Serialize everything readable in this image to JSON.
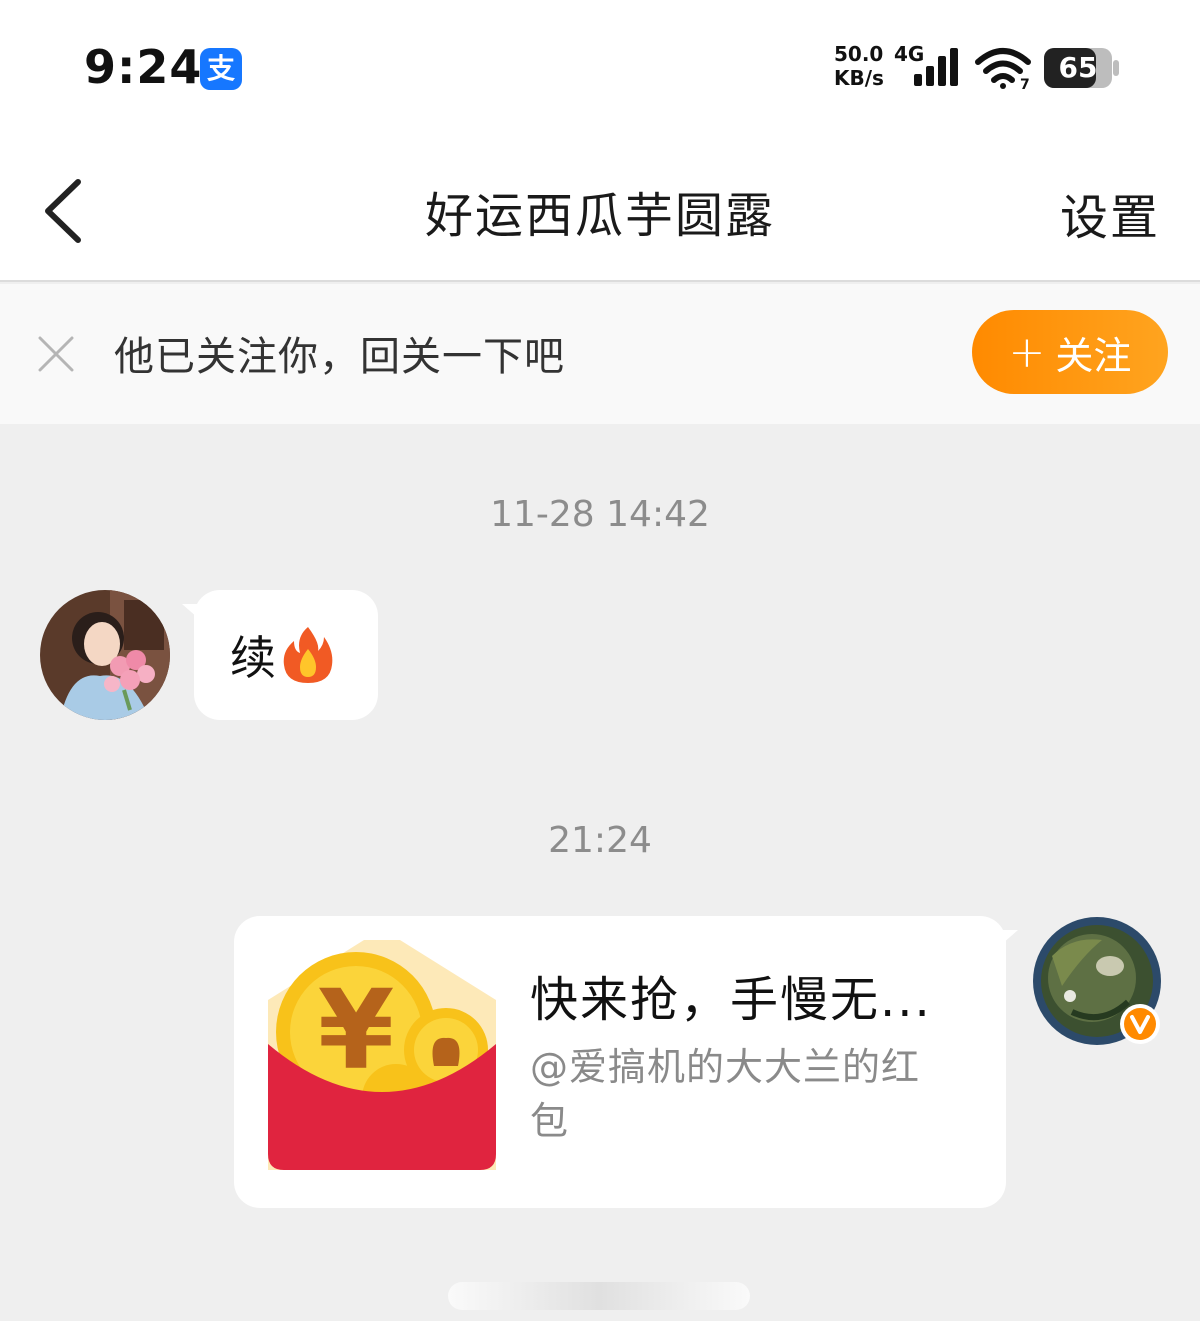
{
  "status_bar": {
    "time": "9:24",
    "app_icon_label": "支",
    "net_speed": "50.0\nKB/s",
    "net_type": "4G",
    "battery": "65"
  },
  "nav": {
    "title": "好运西瓜芋圆露",
    "settings_label": "设置"
  },
  "follow_banner": {
    "hint": "他已关注你，回关一下吧",
    "button_label": "关注"
  },
  "messages": {
    "timestamp_1": "11-28 14:42",
    "incoming_text": "续",
    "timestamp_2": "21:24",
    "card": {
      "title": "快来抢，手慢无...",
      "subtitle": "@爱搞机的大大兰的红包"
    }
  },
  "colors": {
    "accent_orange": "#ff8a00",
    "red_packet": "#e0243f",
    "coin_gold": "#f8c21a"
  }
}
